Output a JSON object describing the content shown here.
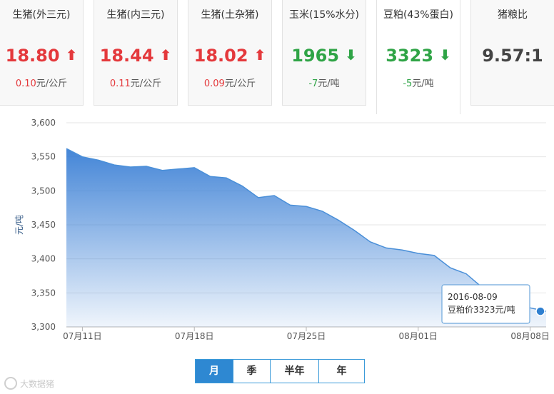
{
  "cards": [
    {
      "name": "生猪(外三元)",
      "price": "18.80",
      "trend": "up",
      "change": "0.10",
      "unit": "元/公斤"
    },
    {
      "name": "生猪(内三元)",
      "price": "18.44",
      "trend": "up",
      "change": "0.11",
      "unit": "元/公斤"
    },
    {
      "name": "生猪(土杂猪)",
      "price": "18.02",
      "trend": "up",
      "change": "0.09",
      "unit": "元/公斤"
    },
    {
      "name": "玉米(15%水分)",
      "price": "1965",
      "trend": "down",
      "change": "-7",
      "unit": "元/吨"
    },
    {
      "name": "豆粕(43%蛋白)",
      "price": "3323",
      "trend": "down",
      "change": "-5",
      "unit": "元/吨",
      "active": true
    },
    {
      "name": "猪粮比",
      "price": "9.57:1",
      "trend": "flat",
      "change": "",
      "unit": ""
    }
  ],
  "colors": {
    "up": "#e4393c",
    "down": "#2fa446",
    "area_top": "#3a7fd5",
    "line": "#4a8fd8",
    "accent": "#2e88d2"
  },
  "icons": {
    "up": "arrow-up-icon",
    "down": "arrow-down-icon"
  },
  "chart_data": {
    "type": "area",
    "ylabel": "元/吨",
    "ylim": [
      3300,
      3600
    ],
    "y_ticks": [
      "3,600",
      "3,550",
      "3,500",
      "3,450",
      "3,400",
      "3,350",
      "3,300"
    ],
    "x_ticks": [
      "07月11日",
      "07月18日",
      "07月25日",
      "08月01日",
      "08月08日"
    ],
    "grid": true,
    "x": [
      "2016-07-10",
      "2016-07-11",
      "2016-07-12",
      "2016-07-13",
      "2016-07-14",
      "2016-07-15",
      "2016-07-16",
      "2016-07-17",
      "2016-07-18",
      "2016-07-19",
      "2016-07-20",
      "2016-07-21",
      "2016-07-22",
      "2016-07-23",
      "2016-07-24",
      "2016-07-25",
      "2016-07-26",
      "2016-07-27",
      "2016-07-28",
      "2016-07-29",
      "2016-07-30",
      "2016-07-31",
      "2016-08-01",
      "2016-08-02",
      "2016-08-03",
      "2016-08-04",
      "2016-08-05",
      "2016-08-06",
      "2016-08-07",
      "2016-08-08",
      "2016-08-09"
    ],
    "values": [
      3562,
      3550,
      3545,
      3538,
      3535,
      3536,
      3530,
      3532,
      3534,
      3521,
      3519,
      3507,
      3490,
      3493,
      3479,
      3477,
      3470,
      3457,
      3442,
      3425,
      3416,
      3413,
      3408,
      3405,
      3387,
      3378,
      3358,
      3345,
      3335,
      3328,
      3323
    ],
    "series": [
      {
        "name": "豆粕价",
        "unit": "元/吨"
      }
    ],
    "tooltip": {
      "date": "2016-08-09",
      "label": "豆粕价3323元/吨"
    }
  },
  "periods": [
    "月",
    "季",
    "半年",
    "年"
  ],
  "active_period": "月",
  "watermark": "大数据猪"
}
